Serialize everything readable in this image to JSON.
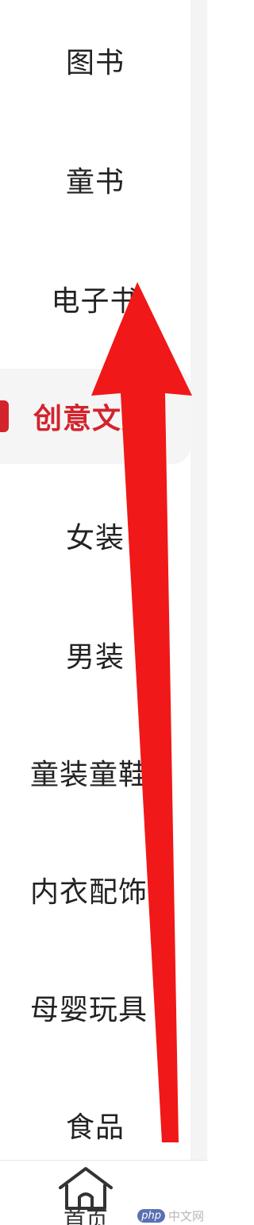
{
  "sidebar": {
    "items": [
      {
        "label": "图书"
      },
      {
        "label": "童书"
      },
      {
        "label": "电子书"
      },
      {
        "label": "创意文具"
      },
      {
        "label": "女装"
      },
      {
        "label": "男装"
      },
      {
        "label": "童装童鞋"
      },
      {
        "label": "内衣配饰"
      },
      {
        "label": "母婴玩具"
      },
      {
        "label": "食品"
      }
    ],
    "active_index": 3
  },
  "bottom_nav": {
    "home_label": "首页",
    "home_icon": "home-icon"
  },
  "watermark": {
    "logo_text": "php",
    "site_text": "中文网"
  },
  "colors": {
    "accent": "#d3232d",
    "annotation_arrow": "#f01818",
    "text": "#222222",
    "active_bg": "#f5f5f5"
  }
}
